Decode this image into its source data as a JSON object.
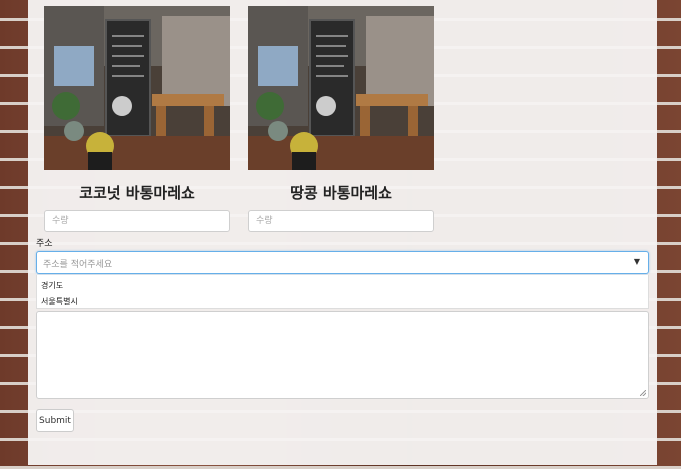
{
  "products": [
    {
      "name": "코코넛 바통마레쇼",
      "qty_placeholder": "수량",
      "image": "cafe-storefront-photo"
    },
    {
      "name": "땅콩 바통마레쇼",
      "qty_placeholder": "수량",
      "image": "cafe-storefront-photo"
    }
  ],
  "address": {
    "label": "주소",
    "placeholder": "주소를 적어주세요",
    "caret": "▼",
    "options": [
      "경기도",
      "서울특별시"
    ]
  },
  "submit_label": "Submit"
}
